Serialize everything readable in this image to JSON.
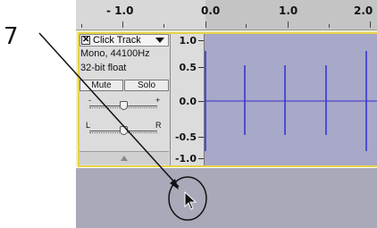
{
  "annotation": {
    "step_number": "7"
  },
  "timeline_ruler": {
    "labels": [
      "- 1.0",
      "0.0",
      "1.0",
      "2.0"
    ]
  },
  "track": {
    "name": "Click Track",
    "close_glyph": "✕",
    "format_line": "Mono, 44100Hz",
    "bit_depth_line": "32-bit float",
    "mute_label": "Mute",
    "solo_label": "Solo",
    "gain_minus": "-",
    "gain_plus": "+",
    "pan_left": "L",
    "pan_right": "R"
  },
  "vertical_scale": {
    "labels": [
      "1.0",
      "0.5",
      "0.0",
      "-0.5",
      "-1.0"
    ]
  },
  "colors": {
    "waveform_bg": "#a8a8c8",
    "waveform_line": "#3030d0",
    "track_selected_border": "#e6d34a",
    "annotation": "#111111"
  },
  "icons": [
    "close-icon",
    "dropdown-arrow-icon",
    "collapse-arrow-icon",
    "mouse-pointer-icon"
  ]
}
